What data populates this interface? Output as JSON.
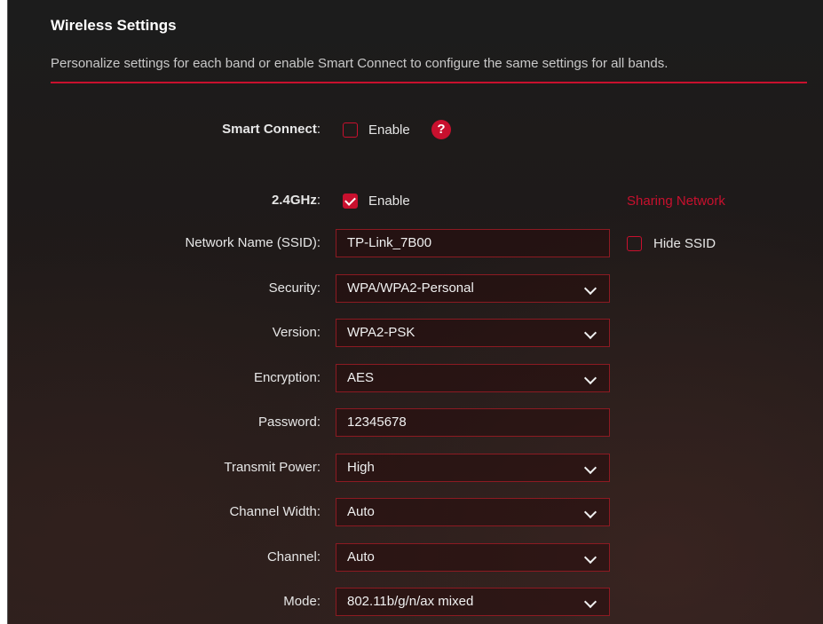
{
  "section": {
    "title": "Wireless Settings",
    "description": "Personalize settings for each band or enable Smart Connect to configure the same settings for all bands."
  },
  "smart_connect": {
    "label": "Smart Connect",
    "colon": ":",
    "enable_label": "Enable",
    "checked": false,
    "help_icon": "question-icon",
    "help_glyph": "?"
  },
  "band_24": {
    "label": "2.4GHz",
    "colon": ":",
    "enable_label": "Enable",
    "checked": true,
    "sharing_network": "Sharing Network",
    "hide_ssid_label": "Hide SSID",
    "hide_ssid_checked": false
  },
  "fields": [
    {
      "label": "Network Name (SSID):",
      "value": "TP-Link_7B00",
      "type": "text"
    },
    {
      "label": "Security:",
      "value": "WPA/WPA2-Personal",
      "type": "select"
    },
    {
      "label": "Version:",
      "value": "WPA2-PSK",
      "type": "select"
    },
    {
      "label": "Encryption:",
      "value": "AES",
      "type": "select"
    },
    {
      "label": "Password:",
      "value": "12345678",
      "type": "text"
    },
    {
      "label": "Transmit Power:",
      "value": "High",
      "type": "select"
    },
    {
      "label": "Channel Width:",
      "value": "Auto",
      "type": "select"
    },
    {
      "label": "Channel:",
      "value": "Auto",
      "type": "select"
    },
    {
      "label": "Mode:",
      "value": "802.11b/g/n/ax mixed",
      "type": "select"
    }
  ],
  "colors": {
    "accent": "#c8102e",
    "background": "#1c1c1c",
    "text": "#e6e6e6"
  }
}
